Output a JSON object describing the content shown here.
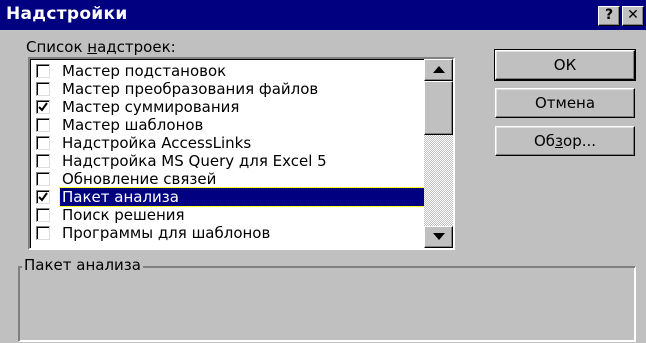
{
  "window": {
    "title": "Надстройки",
    "help_label": "?",
    "close_label": "✕"
  },
  "addins": {
    "label_before": "Список ",
    "label_accel": "н",
    "label_after": "адстроек:",
    "items": [
      {
        "label": "Мастер подстановок",
        "checked": false,
        "selected": false
      },
      {
        "label": "Мастер преобразования файлов",
        "checked": false,
        "selected": false
      },
      {
        "label": "Мастер суммирования",
        "checked": true,
        "selected": false
      },
      {
        "label": "Мастер шаблонов",
        "checked": false,
        "selected": false
      },
      {
        "label": "Надстройка AccessLinks",
        "checked": false,
        "selected": false
      },
      {
        "label": "Надстройка MS Query для Excel 5",
        "checked": false,
        "selected": false
      },
      {
        "label": "Обновление связей",
        "checked": false,
        "selected": false
      },
      {
        "label": "Пакет анализа",
        "checked": true,
        "selected": true
      },
      {
        "label": "Поиск решения",
        "checked": false,
        "selected": false
      },
      {
        "label": "Программы для шаблонов",
        "checked": false,
        "selected": false
      }
    ]
  },
  "buttons": {
    "ok": "ОК",
    "cancel": "Отмена",
    "browse_before": "Об",
    "browse_accel": "з",
    "browse_after": "ор..."
  },
  "description": {
    "legend": "Пакет анализа",
    "text": ""
  },
  "colors": {
    "face": "#c0c0c0",
    "title_bar": "#000080",
    "selection": "#000080"
  }
}
